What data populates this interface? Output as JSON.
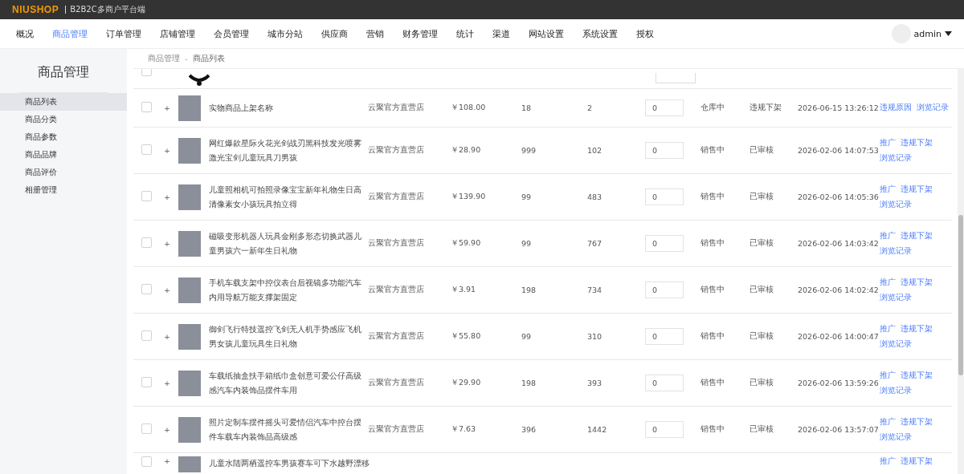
{
  "header": {
    "logo": "NIUSHOP",
    "subtitle": "B2B2C多商户平台端"
  },
  "nav": [
    {
      "label": "概况",
      "selected": false
    },
    {
      "label": "商品管理",
      "selected": true
    },
    {
      "label": "订单管理",
      "selected": false
    },
    {
      "label": "店铺管理",
      "selected": false
    },
    {
      "label": "会员管理",
      "selected": false
    },
    {
      "label": "城市分站",
      "selected": false
    },
    {
      "label": "供应商",
      "selected": false
    },
    {
      "label": "营销",
      "selected": false
    },
    {
      "label": "财务管理",
      "selected": false
    },
    {
      "label": "统计",
      "selected": false
    },
    {
      "label": "渠道",
      "selected": false
    },
    {
      "label": "网站设置",
      "selected": false
    },
    {
      "label": "系统设置",
      "selected": false
    },
    {
      "label": "授权",
      "selected": false
    }
  ],
  "user": {
    "name": "admin"
  },
  "sidebar": {
    "title": "商品管理",
    "items": [
      {
        "label": "商品列表",
        "selected": true
      },
      {
        "label": "商品分类",
        "selected": false
      },
      {
        "label": "商品参数",
        "selected": false
      },
      {
        "label": "商品品牌",
        "selected": false
      },
      {
        "label": "商品评价",
        "selected": false
      },
      {
        "label": "相册管理",
        "selected": false
      }
    ]
  },
  "breadcrumb": {
    "items": [
      "商品管理",
      "商品列表"
    ],
    "separator": "-"
  },
  "table": {
    "rows": [
      {
        "kind": "cut",
        "checked": false
      },
      {
        "kind": "full",
        "checked": false,
        "expand": "+",
        "name": "实物商品上架名称",
        "store": "云聚官方直营店",
        "price": "￥108.00",
        "sales": "18",
        "stock": "2",
        "sort": "0",
        "status": "仓库中",
        "audit": "违规下架",
        "time": "2026-06-15 13:26:12",
        "actions": [
          "违规原因",
          "浏览记录"
        ]
      },
      {
        "kind": "full",
        "checked": false,
        "expand": "+",
        "name": "网红爆款星际火花光剑战刃黑科技发光喷雾激光宝剑儿童玩具刀男孩",
        "store": "云聚官方直营店",
        "price": "￥28.90",
        "sales": "999",
        "stock": "102",
        "sort": "0",
        "status": "销售中",
        "audit": "已审核",
        "time": "2026-02-06 14:07:53",
        "actions": [
          "推广",
          "违规下架",
          "浏览记录"
        ]
      },
      {
        "kind": "full",
        "checked": false,
        "expand": "+",
        "name": "儿童照相机可拍照录像宝宝新年礼物生日高清像素女小孩玩具拍立得",
        "store": "云聚官方直营店",
        "price": "￥139.90",
        "sales": "99",
        "stock": "483",
        "sort": "0",
        "status": "销售中",
        "audit": "已审核",
        "time": "2026-02-06 14:05:36",
        "actions": [
          "推广",
          "违规下架",
          "浏览记录"
        ]
      },
      {
        "kind": "full",
        "checked": false,
        "expand": "+",
        "name": "磁吸变形机器人玩具金刚多形态切换武器儿童男孩六一新年生日礼物",
        "store": "云聚官方直营店",
        "price": "￥59.90",
        "sales": "99",
        "stock": "767",
        "sort": "0",
        "status": "销售中",
        "audit": "已审核",
        "time": "2026-02-06 14:03:42",
        "actions": [
          "推广",
          "违规下架",
          "浏览记录"
        ]
      },
      {
        "kind": "full",
        "checked": false,
        "expand": "+",
        "name": "手机车载支架中控仪表台后视镜多功能汽车内用导航万能支撑架固定",
        "store": "云聚官方直营店",
        "price": "￥3.91",
        "sales": "198",
        "stock": "734",
        "sort": "0",
        "status": "销售中",
        "audit": "已审核",
        "time": "2026-02-06 14:02:42",
        "actions": [
          "推广",
          "违规下架",
          "浏览记录"
        ]
      },
      {
        "kind": "full",
        "checked": false,
        "expand": "+",
        "name": "御剑飞行特技遥控飞剑无人机手势感应飞机男女孩儿童玩具生日礼物",
        "store": "云聚官方直营店",
        "price": "￥55.80",
        "sales": "99",
        "stock": "310",
        "sort": "0",
        "status": "销售中",
        "audit": "已审核",
        "time": "2026-02-06 14:00:47",
        "actions": [
          "推广",
          "违规下架",
          "浏览记录"
        ]
      },
      {
        "kind": "full",
        "checked": false,
        "expand": "+",
        "name": "车载纸抽盒扶手箱纸巾盒创意可爱公仔高级感汽车内装饰品摆件车用",
        "store": "云聚官方直营店",
        "price": "￥29.90",
        "sales": "198",
        "stock": "393",
        "sort": "0",
        "status": "销售中",
        "audit": "已审核",
        "time": "2026-02-06 13:59:26",
        "actions": [
          "推广",
          "违规下架",
          "浏览记录"
        ]
      },
      {
        "kind": "full",
        "checked": false,
        "expand": "+",
        "name": "照片定制车摆件摇头可爱情侣汽车中控台摆件车载车内装饰品高级感",
        "store": "云聚官方直营店",
        "price": "￥7.63",
        "sales": "396",
        "stock": "1442",
        "sort": "0",
        "status": "销售中",
        "audit": "已审核",
        "time": "2026-02-06 13:57:07",
        "actions": [
          "推广",
          "违规下架",
          "浏览记录"
        ]
      },
      {
        "kind": "tail",
        "checked": false,
        "expand": "+",
        "name": "儿童水陆两栖遥控车男孩赛车可下水越野漂移",
        "actions": [
          "推广",
          "违规下架"
        ]
      }
    ]
  }
}
